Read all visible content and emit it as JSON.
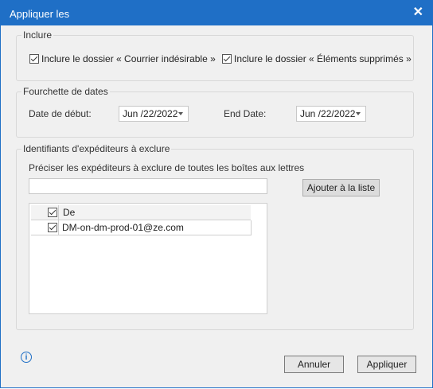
{
  "window": {
    "title": "Appliquer les",
    "close_glyph": "✕"
  },
  "include_group": {
    "title": "Inclure",
    "junk_label": "Inclure le dossier « Courrier indésirable »",
    "deleted_label": "Inclure le dossier « Éléments supprimés »"
  },
  "date_group": {
    "title": "Fourchette de dates",
    "start_label": "Date de début:",
    "start_value": "Jun /22/2022",
    "end_label": "End Date:",
    "end_value": "Jun /22/2022"
  },
  "sender_group": {
    "title": "Identifiants d'expéditeurs à exclure",
    "instruction": "Préciser les expéditeurs à exclure de toutes les boîtes aux lettres",
    "input_value": "",
    "add_button": "Ajouter à la liste",
    "grid": {
      "header": "De",
      "rows": [
        "DM-on-dm-prod-01@ze.com"
      ]
    }
  },
  "footer": {
    "info_glyph": "i",
    "cancel_button": "Annuler",
    "apply_button": "Appliquer"
  }
}
